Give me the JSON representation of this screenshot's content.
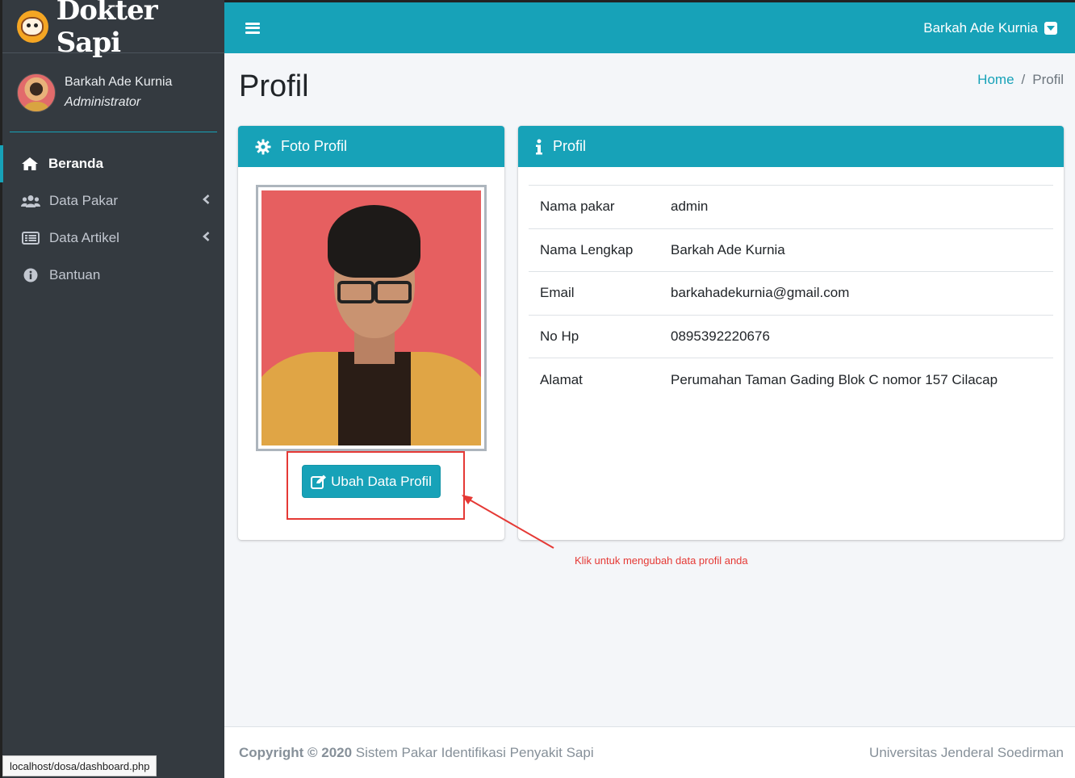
{
  "brand": {
    "name": "Dokter Sapi"
  },
  "user": {
    "name": "Barkah Ade Kurnia",
    "role": "Administrator"
  },
  "sidebar": {
    "items": [
      {
        "label": "Beranda",
        "icon": "home-icon",
        "active": true
      },
      {
        "label": "Data Pakar",
        "icon": "users-icon",
        "has_children": true
      },
      {
        "label": "Data Artikel",
        "icon": "list-alt-icon",
        "has_children": true
      },
      {
        "label": "Bantuan",
        "icon": "info-circle-icon"
      }
    ]
  },
  "topbar": {
    "user_name": "Barkah Ade Kurnia"
  },
  "page": {
    "title": "Profil"
  },
  "breadcrumb": {
    "home": "Home",
    "separator": "/",
    "current": "Profil"
  },
  "foto_card": {
    "title": "Foto Profil",
    "button_label": "Ubah Data Profil"
  },
  "profil_card": {
    "title": "Profil",
    "rows": [
      {
        "label": "Nama pakar",
        "value": "admin"
      },
      {
        "label": "Nama Lengkap",
        "value": "Barkah Ade Kurnia"
      },
      {
        "label": "Email",
        "value": "barkahadekurnia@gmail.com"
      },
      {
        "label": "No Hp",
        "value": "0895392220676"
      },
      {
        "label": "Alamat",
        "value": "Perumahan Taman Gading Blok C nomor 157 Cilacap"
      }
    ]
  },
  "annotation": {
    "text": "Klik untuk mengubah data profil anda",
    "color": "#e53935"
  },
  "footer": {
    "copyright": "Copyright © 2020",
    "system": "Sistem Pakar Identifikasi Penyakit Sapi",
    "university": "Universitas Jenderal Soedirman"
  },
  "statusbar": {
    "url": "localhost/dosa/dashboard.php"
  },
  "colors": {
    "accent": "#17a2b8",
    "sidebar": "#343a40",
    "annotation": "#e53935"
  }
}
